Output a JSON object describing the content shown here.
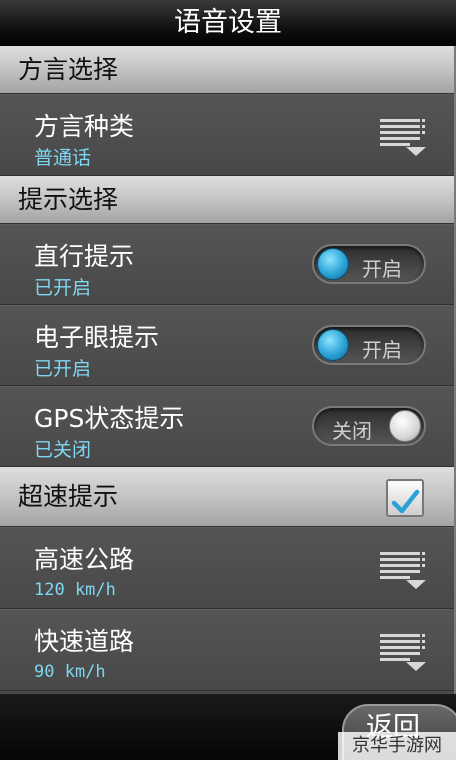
{
  "header": {
    "title": "语音设置"
  },
  "sections": {
    "dialect": {
      "label": "方言选择",
      "item": {
        "title": "方言种类",
        "value": "普通话",
        "icon": "list-menu-icon"
      }
    },
    "prompts": {
      "label": "提示选择",
      "items": [
        {
          "title": "直行提示",
          "status": "已开启",
          "toggle_label": "开启",
          "on": true
        },
        {
          "title": "电子眼提示",
          "status": "已开启",
          "toggle_label": "开启",
          "on": true
        },
        {
          "title": "GPS状态提示",
          "status": "已关闭",
          "toggle_label": "关闭",
          "on": false
        }
      ]
    },
    "overspeed": {
      "label": "超速提示",
      "checked": true,
      "items": [
        {
          "title": "高速公路",
          "value": "120 km/h",
          "icon": "list-menu-icon"
        },
        {
          "title": "快速道路",
          "value": "90 km/h",
          "icon": "list-menu-icon"
        }
      ]
    }
  },
  "footer": {
    "back_label": "返回"
  },
  "watermark": {
    "text": "京华手游网"
  },
  "colors": {
    "accent_blue": "#2aa2d6",
    "status_text": "#7fd6f2"
  }
}
